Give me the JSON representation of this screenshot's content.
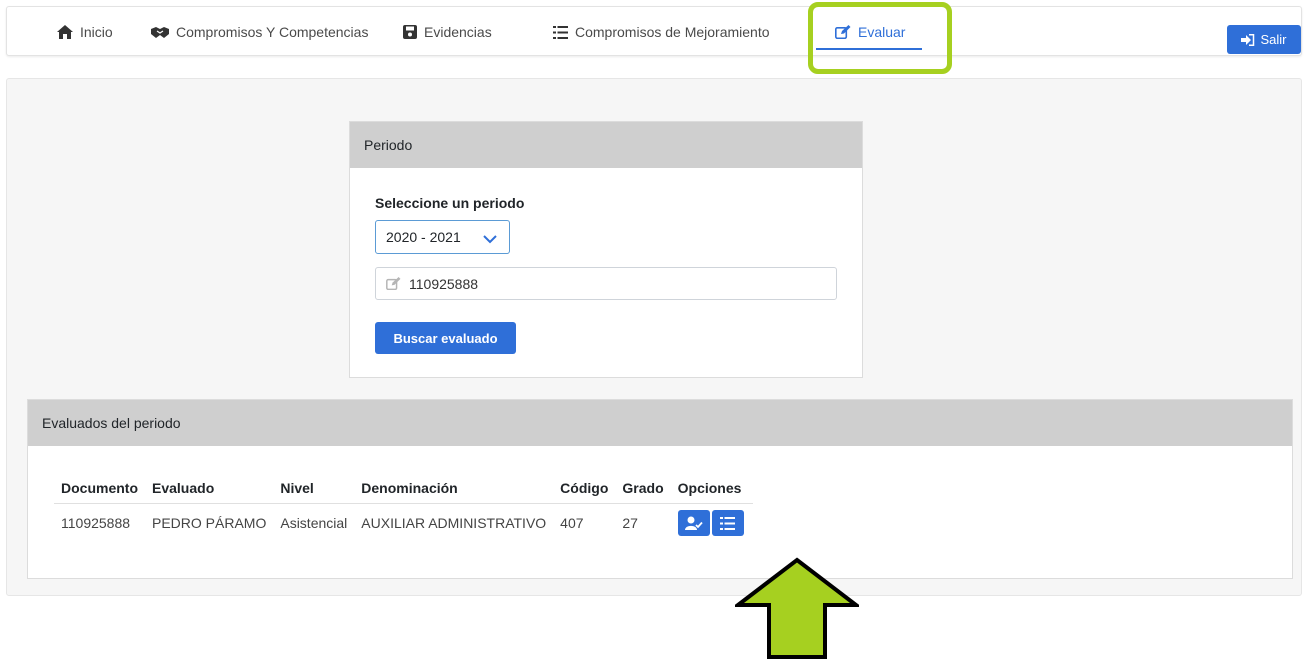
{
  "nav": {
    "items": [
      {
        "label": "Inicio",
        "icon": "home-icon"
      },
      {
        "label": "Compromisos Y Competencias",
        "icon": "handshake-icon"
      },
      {
        "label": "Evidencias",
        "icon": "save-icon"
      },
      {
        "label": "Compromisos de Mejoramiento",
        "icon": "list-icon"
      },
      {
        "label": "Evaluar",
        "icon": "edit-icon"
      }
    ],
    "active": "Evaluar",
    "logout_label": "Salir"
  },
  "periodo": {
    "header": "Periodo",
    "select_label": "Seleccione un periodo",
    "selected_period": "2020 - 2021",
    "document_value": "110925888",
    "search_button": "Buscar evaluado"
  },
  "evaluados": {
    "header": "Evaluados del periodo",
    "columns": [
      "Documento",
      "Evaluado",
      "Nivel",
      "Denominación",
      "Código",
      "Grado",
      "Opciones"
    ],
    "rows": [
      [
        "110925888",
        "PEDRO PÁRAMO",
        "Asistencial",
        "AUXILIAR ADMINISTRATIVO",
        "407",
        "27"
      ]
    ]
  },
  "colors": {
    "primary": "#2f6fd8",
    "highlight": "#a6d020",
    "header_bg": "#cfcfcf"
  }
}
